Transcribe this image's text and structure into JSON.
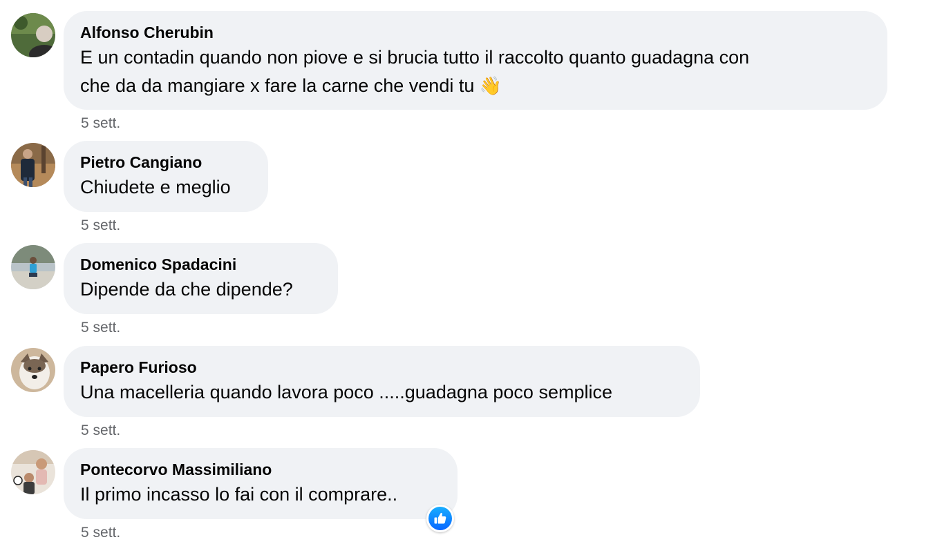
{
  "comments": [
    {
      "author": "Alfonso Cherubin",
      "text_line1": "E un contadin quando non piove e si brucia tutto il raccolto quanto guadagna con",
      "text_line2": "che da da mangiare x fare la carne che vendi tu",
      "emoji": "👋",
      "time": "5 sett.",
      "avatar_icon": "profile-photo-icon"
    },
    {
      "author": "Pietro Cangiano",
      "text": "Chiudete e meglio",
      "time": "5 sett.",
      "avatar_icon": "profile-photo-icon"
    },
    {
      "author": "Domenico Spadacini",
      "text": "Dipende da che dipende?",
      "time": "5 sett.",
      "avatar_icon": "profile-photo-icon"
    },
    {
      "author": "Papero Furioso",
      "text": "Una macelleria quando lavora poco .....guadagna poco semplice",
      "time": "5 sett.",
      "avatar_icon": "profile-photo-icon"
    },
    {
      "author": "Pontecorvo Massimiliano",
      "text": "Il primo incasso lo fai con il comprare..",
      "time": "5 sett.",
      "avatar_icon": "profile-photo-icon",
      "reaction": "like-icon"
    }
  ],
  "colors": {
    "bubble_bg": "#f0f2f5",
    "text": "#050505",
    "secondary_text": "#65676b",
    "like_blue": "#0866ff"
  }
}
